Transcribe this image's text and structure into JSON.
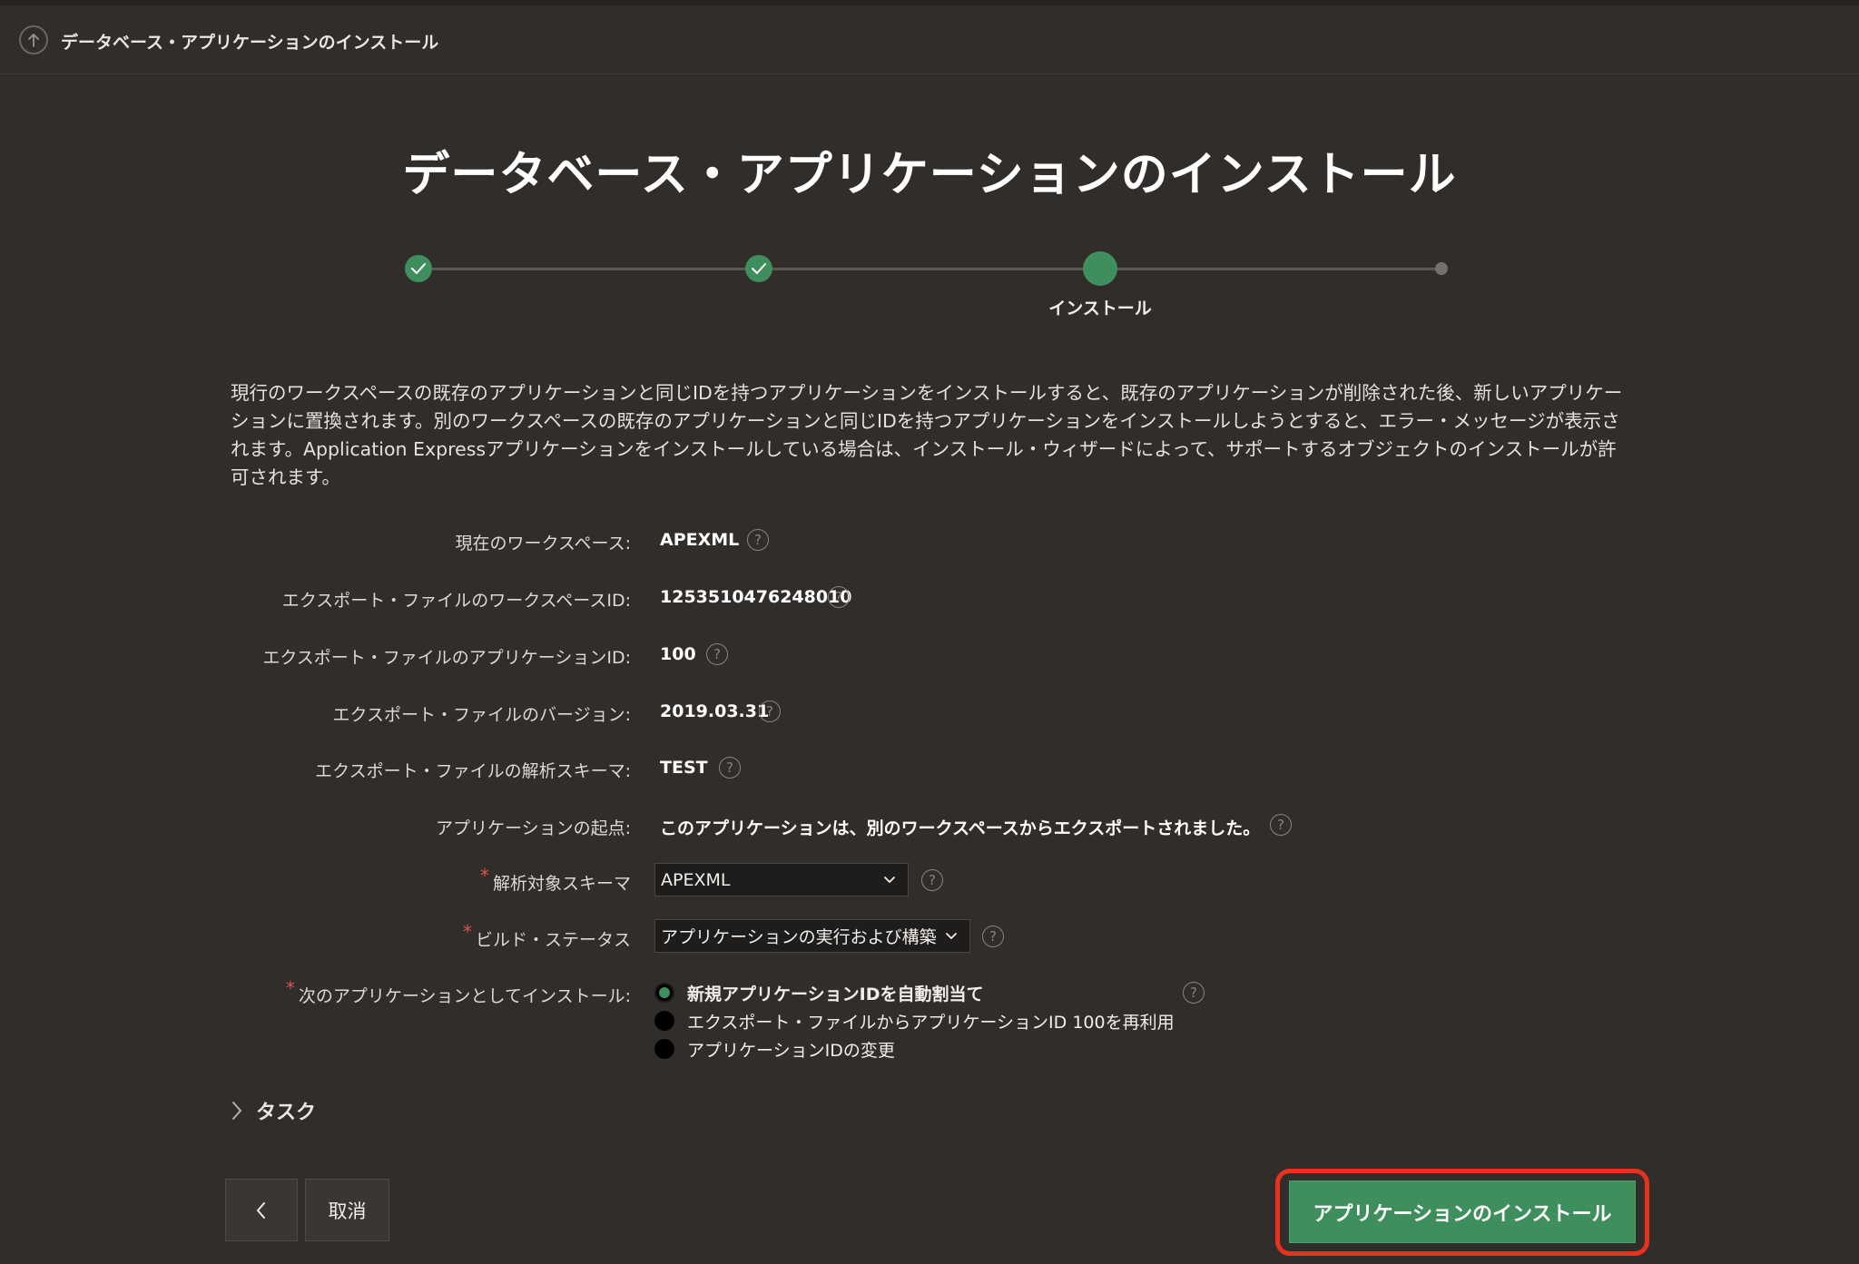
{
  "header": {
    "up_icon": "arrow-up-icon",
    "title": "データベース・アプリケーションのインストール"
  },
  "page": {
    "title": "データベース・アプリケーションのインストール"
  },
  "wizard": {
    "steps": [
      {
        "state": "done",
        "icon": "check-icon"
      },
      {
        "state": "done",
        "icon": "check-icon"
      },
      {
        "state": "current",
        "label": "インストール"
      },
      {
        "state": "future"
      }
    ],
    "accent_color": "#3f8e5d"
  },
  "intro": {
    "text": "現行のワークスペースの既存のアプリケーションと同じIDを持つアプリケーションをインストールすると、既存のアプリケーションが削除された後、新しいアプリケーションに置換されます。別のワークスペースの既存のアプリケーションと同じIDを持つアプリケーションをインストールしようとすると、エラー・メッセージが表示されます。Application Expressアプリケーションをインストールしている場合は、インストール・ウィザードによって、サポートするオブジェクトのインストールが許可されます。"
  },
  "fields": {
    "workspace": {
      "label": "現在のワークスペース:",
      "value": "APEXML"
    },
    "export_workspace_id": {
      "label": "エクスポート・ファイルのワークスペースID:",
      "value": "1253510476248010"
    },
    "export_app_id": {
      "label": "エクスポート・ファイルのアプリケーションID:",
      "value": "100"
    },
    "export_version": {
      "label": "エクスポート・ファイルのバージョン:",
      "value": "2019.03.31"
    },
    "export_schema": {
      "label": "エクスポート・ファイルの解析スキーマ:",
      "value": "TEST"
    },
    "origin": {
      "label": "アプリケーションの起点:",
      "value": "このアプリケーションは、別のワークスペースからエクスポートされました。"
    },
    "parse_schema": {
      "label": "解析対象スキーマ",
      "required": "*",
      "value": "APEXML"
    },
    "build_status": {
      "label": "ビルド・ステータス",
      "required": "*",
      "value": "アプリケーションの実行および構築"
    },
    "install_as": {
      "label": "次のアプリケーションとしてインストール:",
      "required": "*",
      "options": [
        {
          "label": "新規アプリケーションIDを自動割当て",
          "checked": true
        },
        {
          "label": "エクスポート・ファイルからアプリケーションID 100を再利用",
          "checked": false
        },
        {
          "label": "アプリケーションIDの変更",
          "checked": false
        }
      ]
    },
    "help_glyph": "?"
  },
  "tasks": {
    "label": "タスク"
  },
  "buttons": {
    "back_icon": "chevron-left-icon",
    "cancel": "取消",
    "install": "アプリケーションのインストール"
  },
  "highlight_color": "#e8321f"
}
